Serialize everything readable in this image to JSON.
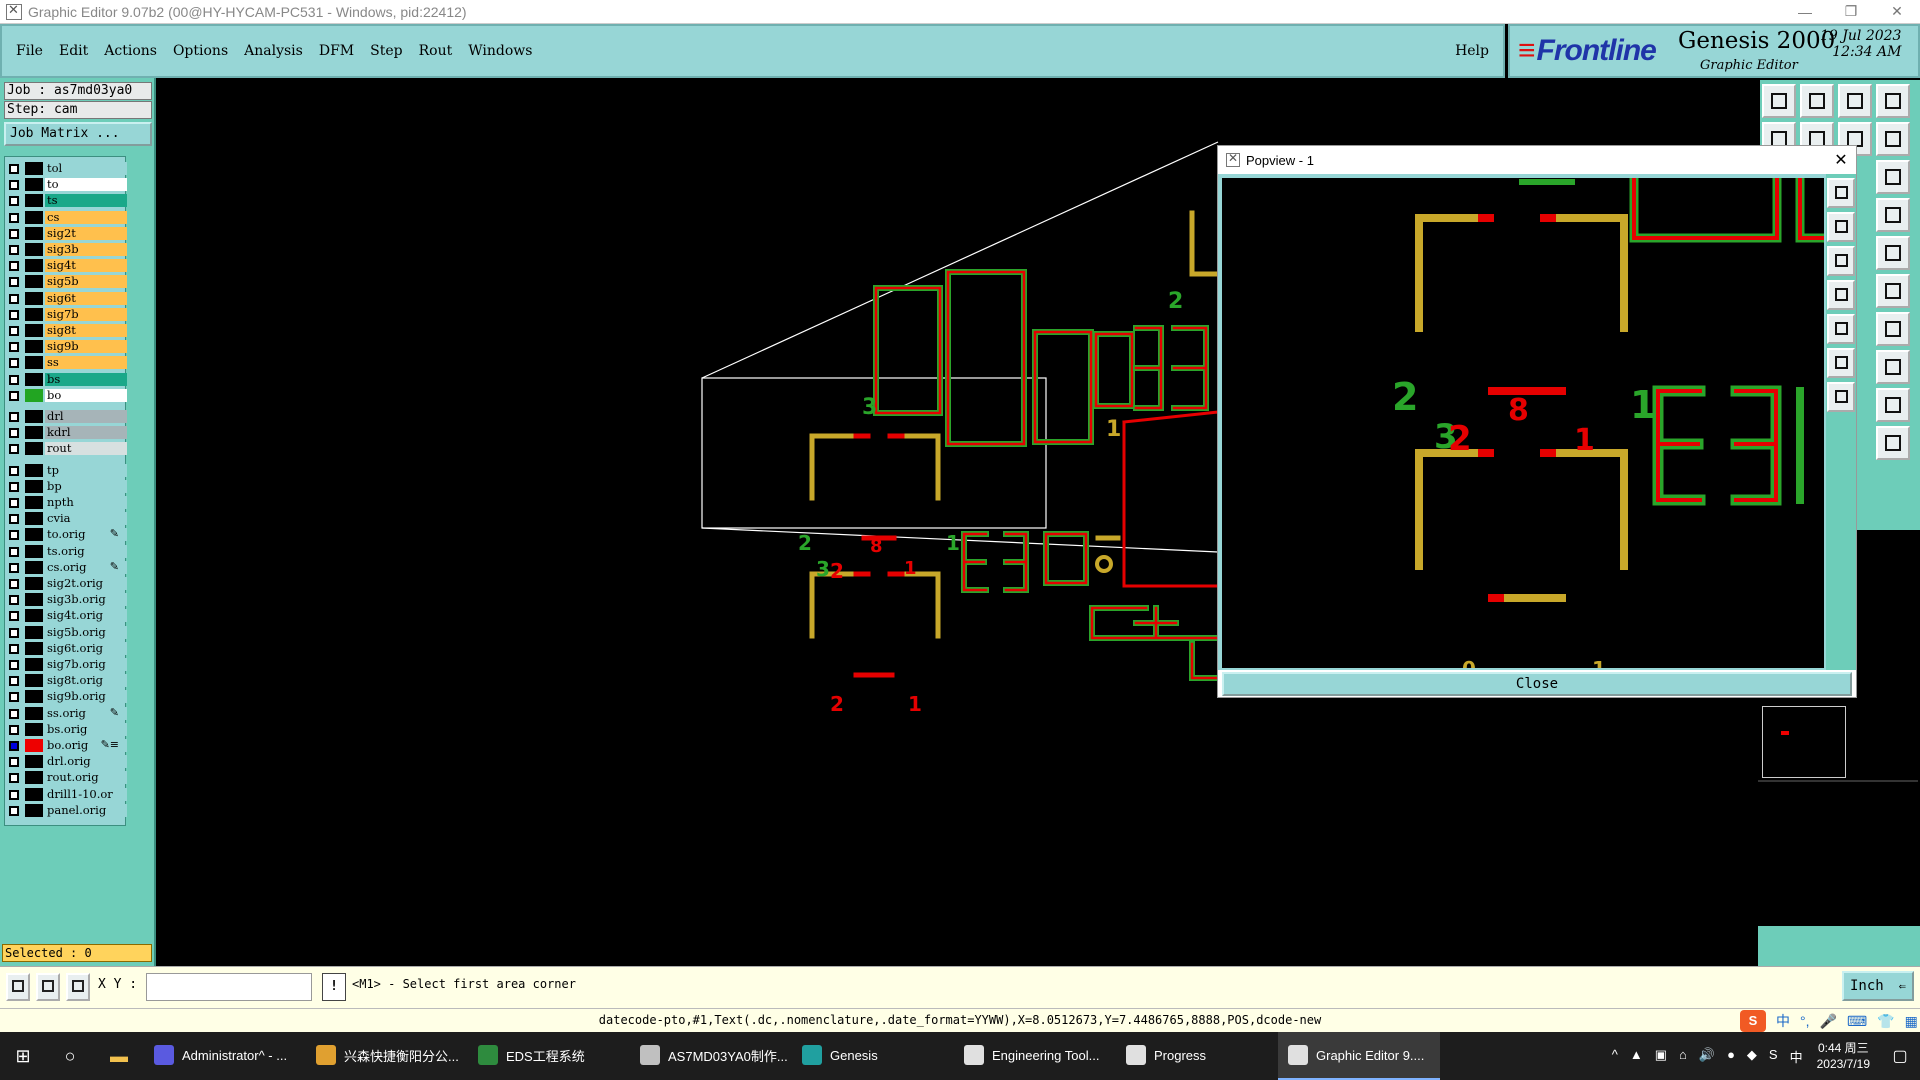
{
  "window": {
    "title": "Graphic Editor 9.07b2 (00@HY-HYCAM-PC531 - Windows, pid:22412)",
    "minimize": "—",
    "restore": "❐",
    "close": "✕"
  },
  "menu": {
    "items": [
      "File",
      "Edit",
      "Actions",
      "Options",
      "Analysis",
      "DFM",
      "Step",
      "Rout",
      "Windows"
    ],
    "help": "Help"
  },
  "brand": {
    "logo": "Frontline",
    "product": "Genesis 2000",
    "subtitle": "Graphic Editor",
    "date": "19 Jul 2023",
    "time": "12:34 AM"
  },
  "job": {
    "job_label": "Job : as7md03ya0",
    "step_label": "Step: cam",
    "matrix_button": "Job Matrix ..."
  },
  "layers": [
    {
      "name": "tol",
      "color": "#97d6d6",
      "swatch": "#000",
      "selected": false
    },
    {
      "name": "to",
      "color": "#ffffff",
      "swatch": "#000",
      "selected": false
    },
    {
      "name": "ts",
      "color": "#1aa889",
      "swatch": "#000",
      "selected": false
    },
    {
      "name": "cs",
      "color": "#ffc04d",
      "swatch": "#000",
      "selected": false
    },
    {
      "name": "sig2t",
      "color": "#ffc04d",
      "swatch": "#000",
      "selected": false
    },
    {
      "name": "sig3b",
      "color": "#ffc04d",
      "swatch": "#000",
      "selected": false
    },
    {
      "name": "sig4t",
      "color": "#ffc04d",
      "swatch": "#000",
      "selected": false
    },
    {
      "name": "sig5b",
      "color": "#ffc04d",
      "swatch": "#000",
      "selected": false
    },
    {
      "name": "sig6t",
      "color": "#ffc04d",
      "swatch": "#000",
      "selected": false
    },
    {
      "name": "sig7b",
      "color": "#ffc04d",
      "swatch": "#000",
      "selected": false
    },
    {
      "name": "sig8t",
      "color": "#ffc04d",
      "swatch": "#000",
      "selected": false
    },
    {
      "name": "sig9b",
      "color": "#ffc04d",
      "swatch": "#000",
      "selected": false
    },
    {
      "name": "ss",
      "color": "#ffc04d",
      "swatch": "#000",
      "selected": false
    },
    {
      "name": "bs",
      "color": "#1aa889",
      "swatch": "#000",
      "selected": false
    },
    {
      "name": "bo",
      "color": "#ffffff",
      "swatch": "#22a522",
      "selected": false
    },
    {
      "name": "drl",
      "color": "#a6b4b8",
      "swatch": "#000",
      "selected": false,
      "gap": true
    },
    {
      "name": "kdrl",
      "color": "#a6b4b8",
      "swatch": "#000",
      "selected": false
    },
    {
      "name": "rout",
      "color": "#d7e0e0",
      "swatch": "#000",
      "selected": false
    },
    {
      "name": "tp",
      "color": "#97d6d6",
      "swatch": "#000",
      "selected": false,
      "gap": true
    },
    {
      "name": "bp",
      "color": "#97d6d6",
      "swatch": "#000",
      "selected": false
    },
    {
      "name": "npth",
      "color": "#97d6d6",
      "swatch": "#000",
      "selected": false
    },
    {
      "name": "cvia",
      "color": "#97d6d6",
      "swatch": "#000",
      "selected": false
    },
    {
      "name": "to.orig",
      "color": "#97d6d6",
      "swatch": "#000",
      "selected": false,
      "mark": "✎"
    },
    {
      "name": "ts.orig",
      "color": "#97d6d6",
      "swatch": "#000",
      "selected": false
    },
    {
      "name": "cs.orig",
      "color": "#97d6d6",
      "swatch": "#000",
      "selected": false,
      "mark": "✎"
    },
    {
      "name": "sig2t.orig",
      "color": "#97d6d6",
      "swatch": "#000",
      "selected": false
    },
    {
      "name": "sig3b.orig",
      "color": "#97d6d6",
      "swatch": "#000",
      "selected": false
    },
    {
      "name": "sig4t.orig",
      "color": "#97d6d6",
      "swatch": "#000",
      "selected": false
    },
    {
      "name": "sig5b.orig",
      "color": "#97d6d6",
      "swatch": "#000",
      "selected": false
    },
    {
      "name": "sig6t.orig",
      "color": "#97d6d6",
      "swatch": "#000",
      "selected": false
    },
    {
      "name": "sig7b.orig",
      "color": "#97d6d6",
      "swatch": "#000",
      "selected": false
    },
    {
      "name": "sig8t.orig",
      "color": "#97d6d6",
      "swatch": "#000",
      "selected": false
    },
    {
      "name": "sig9b.orig",
      "color": "#97d6d6",
      "swatch": "#000",
      "selected": false
    },
    {
      "name": "ss.orig",
      "color": "#97d6d6",
      "swatch": "#000",
      "selected": false,
      "mark": "✎"
    },
    {
      "name": "bs.orig",
      "color": "#97d6d6",
      "swatch": "#000",
      "selected": false
    },
    {
      "name": "bo.orig",
      "color": "#97d6d6",
      "swatch": "#ee0000",
      "selected": true,
      "mark": "✎≡"
    },
    {
      "name": "drl.orig",
      "color": "#97d6d6",
      "swatch": "#000",
      "selected": false
    },
    {
      "name": "rout.orig",
      "color": "#97d6d6",
      "swatch": "#000",
      "selected": false
    },
    {
      "name": "drill1-10.or",
      "color": "#97d6d6",
      "swatch": "#000",
      "selected": false
    },
    {
      "name": "panel.orig",
      "color": "#97d6d6",
      "swatch": "#000",
      "selected": false
    }
  ],
  "selected_label": "Selected : 0",
  "popview": {
    "title": "Popview - 1",
    "close_x": "✕",
    "close_button": "Close"
  },
  "cmdbar": {
    "xy_label": "X Y :",
    "xy_value": "",
    "excl": "!",
    "status": "<M1> - Select first area corner",
    "units": "Inch",
    "units_arrow": "⇐"
  },
  "infobar": "datecode-pto,#1,Text(.dc,.nomenclature,.date_format=YYWW),X=8.0512673,Y=7.4486765,8888,POS,dcode-new",
  "ime": {
    "logo": "S",
    "lang": "中",
    "punct": "°,",
    "mic": "🎤",
    "kbd": "⌨",
    "shirt": "👕",
    "grid": "▦"
  },
  "taskbar": {
    "start": "⊞",
    "search": "○",
    "explorer": "▬",
    "tasks": [
      {
        "label": "Administrator^ - ...",
        "icon_color": "#5a5ae0",
        "active": false
      },
      {
        "label": "兴森快捷衡阳分公...",
        "icon_color": "#e0a030",
        "active": false
      },
      {
        "label": "EDS工程系统",
        "icon_color": "#2e8b3e",
        "active": false
      },
      {
        "label": "AS7MD03YA0制作...",
        "icon_color": "#c0c0c0",
        "active": false
      },
      {
        "label": "Genesis",
        "icon_color": "#20a0a0",
        "active": false
      },
      {
        "label": "Engineering Tool...",
        "icon_color": "#e0e0e0",
        "active": false
      },
      {
        "label": "Progress",
        "icon_color": "#e0e0e0",
        "active": false
      },
      {
        "label": "Graphic Editor 9....",
        "icon_color": "#e0e0e0",
        "active": true
      }
    ],
    "tray_icons": [
      "^",
      "▲",
      "▣",
      "⌂",
      "🔊",
      "●",
      "◆",
      "S",
      "中"
    ],
    "clock_time": "0:44 周三",
    "clock_date": "2023/7/19",
    "notif": "▢"
  }
}
